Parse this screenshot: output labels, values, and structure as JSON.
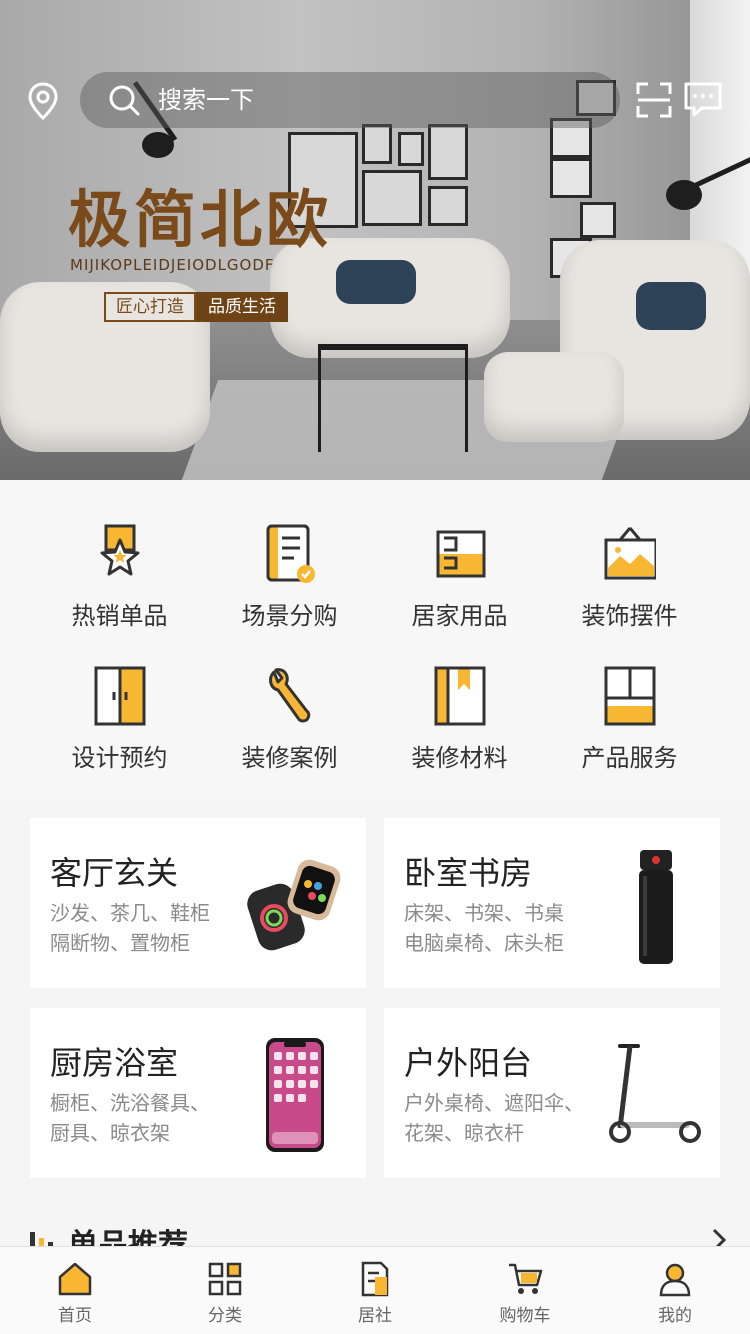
{
  "header": {
    "search_placeholder": "搜索一下",
    "location_icon": "location-pin-icon",
    "scan_icon": "scan-icon",
    "message_icon": "message-icon"
  },
  "banner": {
    "title": "极简北欧",
    "subtitle": "MIJIKOPLEIDJEIODLGODF",
    "tag_1": "匠心打造",
    "tag_2": "品质生活"
  },
  "categories": [
    {
      "label": "热销单品",
      "icon": "hot-badge-icon"
    },
    {
      "label": "场景分购",
      "icon": "checklist-icon"
    },
    {
      "label": "居家用品",
      "icon": "home-goods-icon"
    },
    {
      "label": "装饰摆件",
      "icon": "picture-frame-icon"
    },
    {
      "label": "设计预约",
      "icon": "wardrobe-icon"
    },
    {
      "label": "装修案例",
      "icon": "wrench-icon"
    },
    {
      "label": "装修材料",
      "icon": "book-icon"
    },
    {
      "label": "产品服务",
      "icon": "cabinet-icon"
    }
  ],
  "cards": [
    {
      "title": "客厅玄关",
      "desc_1": "沙发、茶几、鞋柜",
      "desc_2": "隔断物、置物柜",
      "image": "smartwatch-image"
    },
    {
      "title": "卧室书房",
      "desc_1": "床架、书架、书桌",
      "desc_2": "电脑桌椅、床头柜",
      "image": "thermos-bottle-image"
    },
    {
      "title": "厨房浴室",
      "desc_1": "橱柜、洗浴餐具、",
      "desc_2": "厨具、晾衣架",
      "image": "smartphone-image"
    },
    {
      "title": "户外阳台",
      "desc_1": "户外桌椅、遮阳伞、",
      "desc_2": "花架、晾衣杆",
      "image": "scooter-image"
    }
  ],
  "section": {
    "title": "单品推荐"
  },
  "tabbar": [
    {
      "label": "首页",
      "icon": "home-icon",
      "active": true
    },
    {
      "label": "分类",
      "icon": "grid-icon",
      "active": false
    },
    {
      "label": "居社",
      "icon": "community-icon",
      "active": false
    },
    {
      "label": "购物车",
      "icon": "cart-icon",
      "active": false
    },
    {
      "label": "我的",
      "icon": "profile-icon",
      "active": false
    }
  ],
  "colors": {
    "accent": "#f7b733",
    "banner_brown": "#7a4a1a",
    "icon_stroke": "#333333"
  }
}
